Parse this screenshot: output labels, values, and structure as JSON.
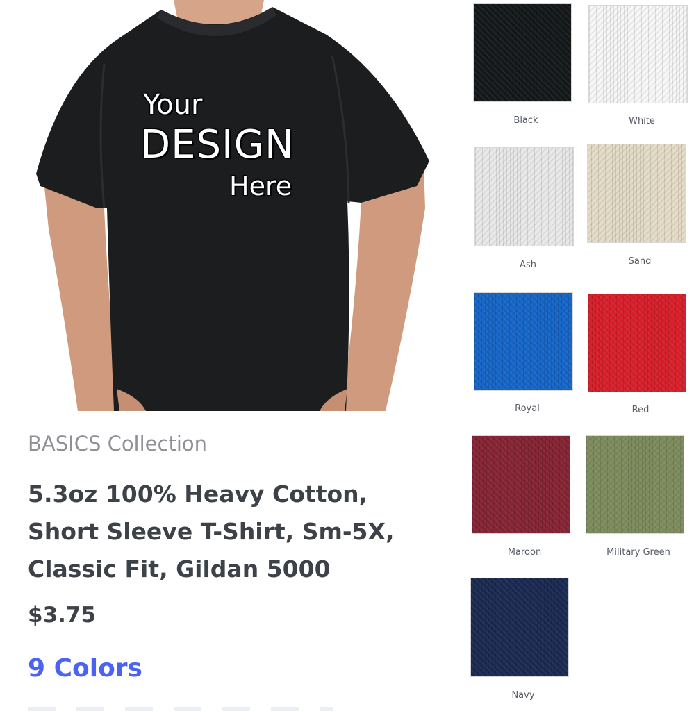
{
  "hero": {
    "design_line1": "Your",
    "design_line2": "DESIGN",
    "design_line3": "Here"
  },
  "product": {
    "collection": "BASICS Collection",
    "title_lines": [
      "5.3oz 100% Heavy Cotton,",
      "Short Sleeve T-Shirt, Sm-5X,",
      "Classic Fit, Gildan 5000"
    ],
    "price": "$3.75",
    "colors_link": "9 Colors"
  },
  "swatches": [
    {
      "label": "Black",
      "color": "#14181a"
    },
    {
      "label": "White",
      "color": "#f7f7f7"
    },
    {
      "label": "Ash",
      "color": "#e9e9ea"
    },
    {
      "label": "Sand",
      "color": "#e4dcc6"
    },
    {
      "label": "Royal",
      "color": "#1566c8"
    },
    {
      "label": "Red",
      "color": "#d81f2a"
    },
    {
      "label": "Maroon",
      "color": "#862434"
    },
    {
      "label": "Military Green",
      "color": "#7d8c5c"
    },
    {
      "label": "Navy",
      "color": "#1b2a52"
    }
  ],
  "shirt_color": "#1c1d1f",
  "skin_color": "#d6a488"
}
